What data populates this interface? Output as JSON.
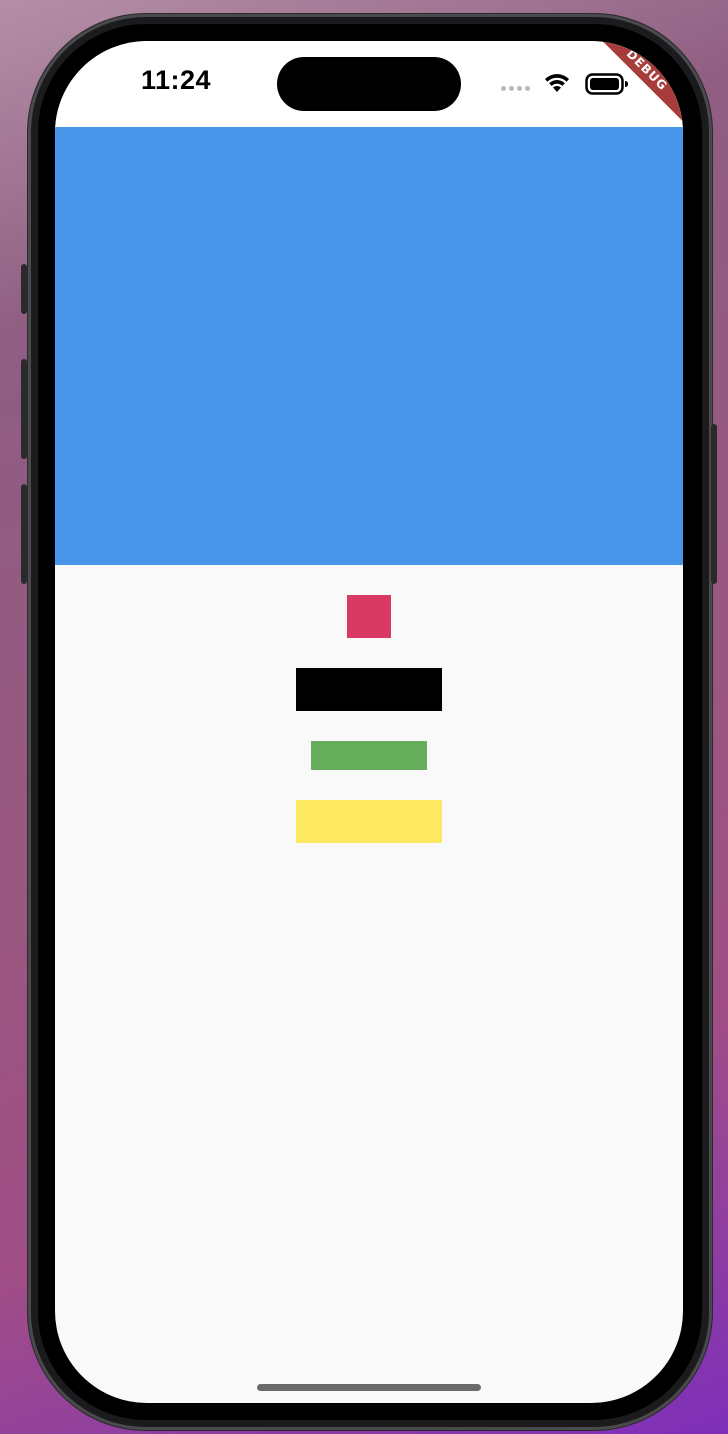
{
  "status_bar": {
    "time": "11:24",
    "icons": [
      "signal-dots-icon",
      "wifi-icon",
      "battery-icon"
    ]
  },
  "debug_banner": {
    "label": "DEBUG",
    "color": "#a83c3a"
  },
  "colors": {
    "top_panel": "#4896e9",
    "background": "#f9f9f9",
    "blocks": [
      "#d83a63",
      "#000000",
      "#66ad5c",
      "#fde961"
    ]
  }
}
